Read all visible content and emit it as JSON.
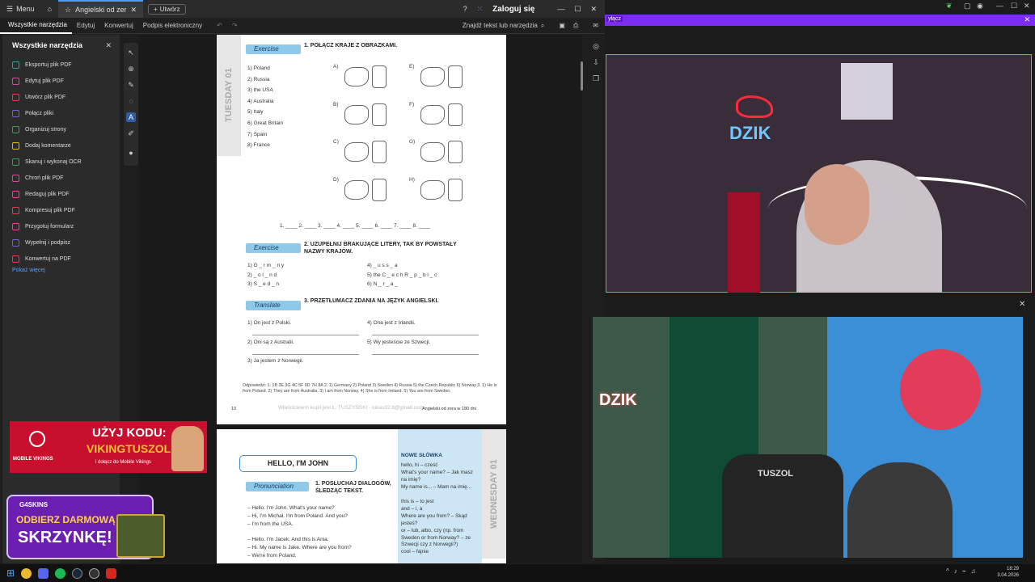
{
  "titlebar": {
    "menu_label": "Menu",
    "tab_title": "Angielski od zera w ...",
    "new_tab_label": "Utwórz",
    "sign_in": "Zaloguj się"
  },
  "toolbar": {
    "tabs": [
      "Wszystkie narzędzia",
      "Edytuj",
      "Konwertuj",
      "Podpis elektroniczny"
    ],
    "search_tools": "Znajdź tekst lub narzędzia"
  },
  "sidepanel": {
    "title": "Wszystkie narzędzia",
    "items": [
      {
        "label": "Eksportuj plik PDF",
        "color": "#2aa39a"
      },
      {
        "label": "Edytuj plik PDF",
        "color": "#e2489a"
      },
      {
        "label": "Utwórz plik PDF",
        "color": "#e53e3e"
      },
      {
        "label": "Połącz pliki",
        "color": "#7b5cd6"
      },
      {
        "label": "Organizuj strony",
        "color": "#31a545"
      },
      {
        "label": "Dodaj komentarze",
        "color": "#e6b800"
      },
      {
        "label": "Skanuj i wykonaj OCR",
        "color": "#31a545"
      },
      {
        "label": "Chroń plik PDF",
        "color": "#e2489a"
      },
      {
        "label": "Redaguj plik PDF",
        "color": "#e2489a"
      },
      {
        "label": "Kompresuj plik PDF",
        "color": "#e53e3e"
      },
      {
        "label": "Przygotuj formularz",
        "color": "#e2489a"
      },
      {
        "label": "Wypełnij i podpisz",
        "color": "#7b5cd6"
      },
      {
        "label": "Konwertuj na PDF",
        "color": "#e53e3e"
      }
    ],
    "more": "Pokaż więcej"
  },
  "page1": {
    "day": "TUESDAY",
    "day_num": "01",
    "ex1_ribbon": "Exercise",
    "ex1_title": "1.  POŁĄCZ KRAJE Z OBRAZKAMI.",
    "countries": [
      "1)  Poland",
      "2)  Russia",
      "3)  the USA",
      "4)  Australia",
      "5)  Italy",
      "6)  Great Britain",
      "7)  Spain",
      "8)  France"
    ],
    "pic_letters": [
      "A)",
      "B)",
      "C)",
      "D)",
      "E)",
      "F)",
      "G)",
      "H)"
    ],
    "answer_line": "1. ____  2. ____  3. ____  4. ____  5. ____  6. ____  7. ____  8. ____",
    "ex2_ribbon": "Exercise",
    "ex2_title": "2.  UZUPEŁNIJ BRAKUJĄCE LITERY, TAK BY POWSTAŁY NAZWY KRAJÓW.",
    "ex2_left": [
      "1)  G _ r m _ n y",
      "2)  _ o l _ n d",
      "3)  S _ e d _ n"
    ],
    "ex2_right": [
      "4)  _ u s s _ a",
      "5)  the C _ e c h  R _ p _ b l _ c",
      "6)  N _ r _ a _"
    ],
    "ex3_ribbon": "Translate",
    "ex3_title": "3.  PRZETŁUMACZ ZDANIA NA JĘZYK ANGIELSKI.",
    "ex3_left": [
      "1)  On jest z Polski.",
      "2)  Oni są z Australii.",
      "3)  Ja jestem z Norwegii."
    ],
    "ex3_right": [
      "4)  Ona jest z Irlandii.",
      "5)  Wy jesteście ze Szwecji."
    ],
    "answers": "Odpowiedzi: 1. 1B 2E 3G 4C 5F 6D 7H 8A 2. 1) Germany 2) Poland 3) Sweden 4) Russia 5) the Czech Republic 6) Norway 3. 1) He is from Poland. 2) They are from Australia. 3) I am from Norway. 4) She is from Ireland. 5) You are from Sweden.",
    "footer_left": "10",
    "watermark": "Właścicielem kopii jest Ł. TUSZYŃSKI - lukas92.tl@gmail.com",
    "footer_right": "Angielski od zera w 180 dni"
  },
  "page2": {
    "title": "HELLO, I'M JOHN",
    "ribbon": "Pronunciation",
    "ex_title": "1.  POSŁUCHAJ DIALOGÓW, ŚLEDZĄC TEKST.",
    "dialog": [
      "– Hello. I'm John. What's your name?",
      "– Hi, I'm Michał. I'm from Poland. And you?",
      "– I'm from the USA.",
      "",
      "– Hello. I'm Jacek. And this is Ania.",
      "– Hi. My name is Jake. Where are you from?",
      "– We're from Poland."
    ],
    "vocab_title": "NOWE SŁÓWKA",
    "vocab": [
      "hello, hi – cześć",
      "What's your name? – Jak masz na imię?",
      "My name is... – Mam na imię...",
      "this is – to jest",
      "and – i, a",
      "Where are you from? – Skąd jesteś?",
      "or – lub, albo, czy (np. from Sweden or from Norway? – ze Szwecji czy z Norwegii?)",
      "cool – fajnie"
    ],
    "day": "WEDNESDAY",
    "day_num": "01"
  },
  "ad1": {
    "code_label": "UŻYJ KODU:",
    "code": "VIKINGTUSZOL",
    "sub": "i dołącz do Mobile Vikings",
    "brand": "MOBILE VIKINGS"
  },
  "ad2": {
    "brand": "G4SKINS",
    "line1": "ODBIERZ DARMOWĄ",
    "line2": "SKRZYNKĘ!"
  },
  "stream": {
    "banner_text": "yłącz",
    "logo": "DZIK",
    "chair": "TUSZOL"
  },
  "clock": {
    "time": "18:29",
    "date": "3.04.2026"
  }
}
